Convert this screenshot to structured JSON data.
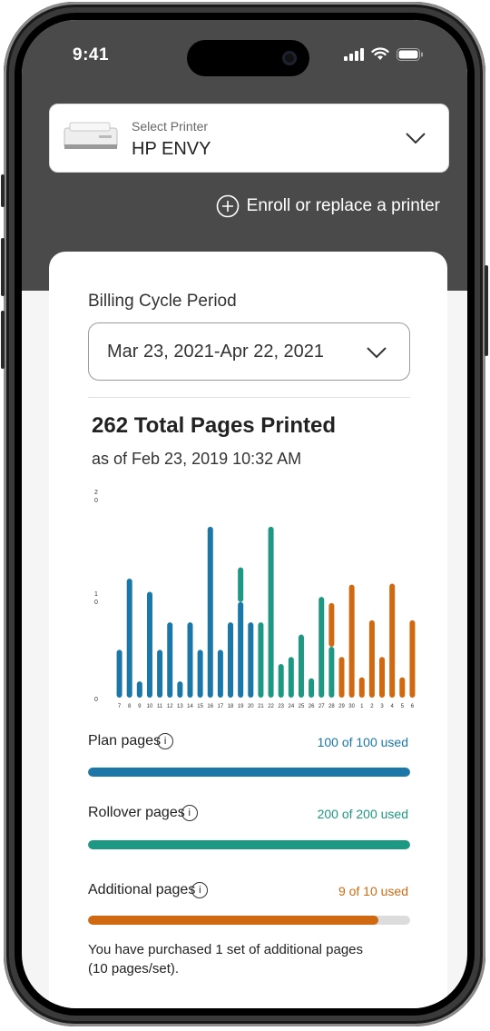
{
  "status_bar": {
    "time": "9:41"
  },
  "printer_selector": {
    "label": "Select Printer",
    "printer_name": "HP ENVY"
  },
  "enroll_link": {
    "label": "Enroll or replace a printer"
  },
  "billing": {
    "label": "Billing Cycle Period",
    "selected_period": "Mar 23, 2021-Apr 22, 2021"
  },
  "summary": {
    "total_pages": "262 Total Pages Printed",
    "as_of": "as of Feb 23, 2019 10:32 AM"
  },
  "colors": {
    "plan": "#1a77a8",
    "rollover": "#1d9883",
    "additional": "#cf6a12",
    "track": "#dcdcdc"
  },
  "chart_data": {
    "type": "bar",
    "stacked": true,
    "y_ticks": [
      "2\n0",
      "1\n0",
      "0"
    ],
    "ylim": [
      0,
      20
    ],
    "categories": [
      "7",
      "8",
      "9",
      "10",
      "11",
      "12",
      "13",
      "14",
      "15",
      "16",
      "17",
      "18",
      "19",
      "20",
      "21",
      "22",
      "23",
      "24",
      "25",
      "26",
      "27",
      "28",
      "29",
      "30",
      "1",
      "2",
      "3",
      "4",
      "5",
      "6"
    ],
    "series": [
      {
        "values": [
          4.7,
          11.7,
          1.6,
          10.4,
          4.7,
          7.4,
          1.6,
          7.4,
          4.7,
          16.8,
          4.7,
          7.4,
          9.4,
          7.4,
          0,
          0,
          0,
          0,
          0,
          0,
          0,
          0,
          0,
          0,
          0,
          0,
          0,
          0,
          0,
          0
        ]
      },
      {
        "values": [
          0,
          0,
          0,
          0,
          0,
          0,
          0,
          0,
          0,
          0,
          0,
          0,
          3.4,
          0,
          7.4,
          16.8,
          3.3,
          4.0,
          6.2,
          1.9,
          9.9,
          5.0,
          0,
          0,
          0,
          0,
          0,
          0,
          0,
          0
        ]
      },
      {
        "values": [
          0,
          0,
          0,
          0,
          0,
          0,
          0,
          0,
          0,
          0,
          0,
          0,
          0,
          0,
          0,
          0,
          0,
          0,
          0,
          0,
          0,
          4.3,
          4.0,
          11.1,
          2.0,
          7.6,
          4.0,
          11.2,
          2.0,
          7.6
        ]
      }
    ]
  },
  "usage": {
    "plan": {
      "label": "Plan pages",
      "info_icon": "i",
      "value": "100 of 100 used",
      "fraction": 1.0
    },
    "rollover": {
      "label": "Rollover pages",
      "info_icon": "i",
      "value": "200 of 200 used",
      "fraction": 1.0
    },
    "additional": {
      "label": "Additional pages",
      "info_icon": "i",
      "value": "9 of 10 used",
      "fraction": 0.9,
      "note": "You have purchased 1 set of additional pages (10 pages/set)."
    }
  }
}
